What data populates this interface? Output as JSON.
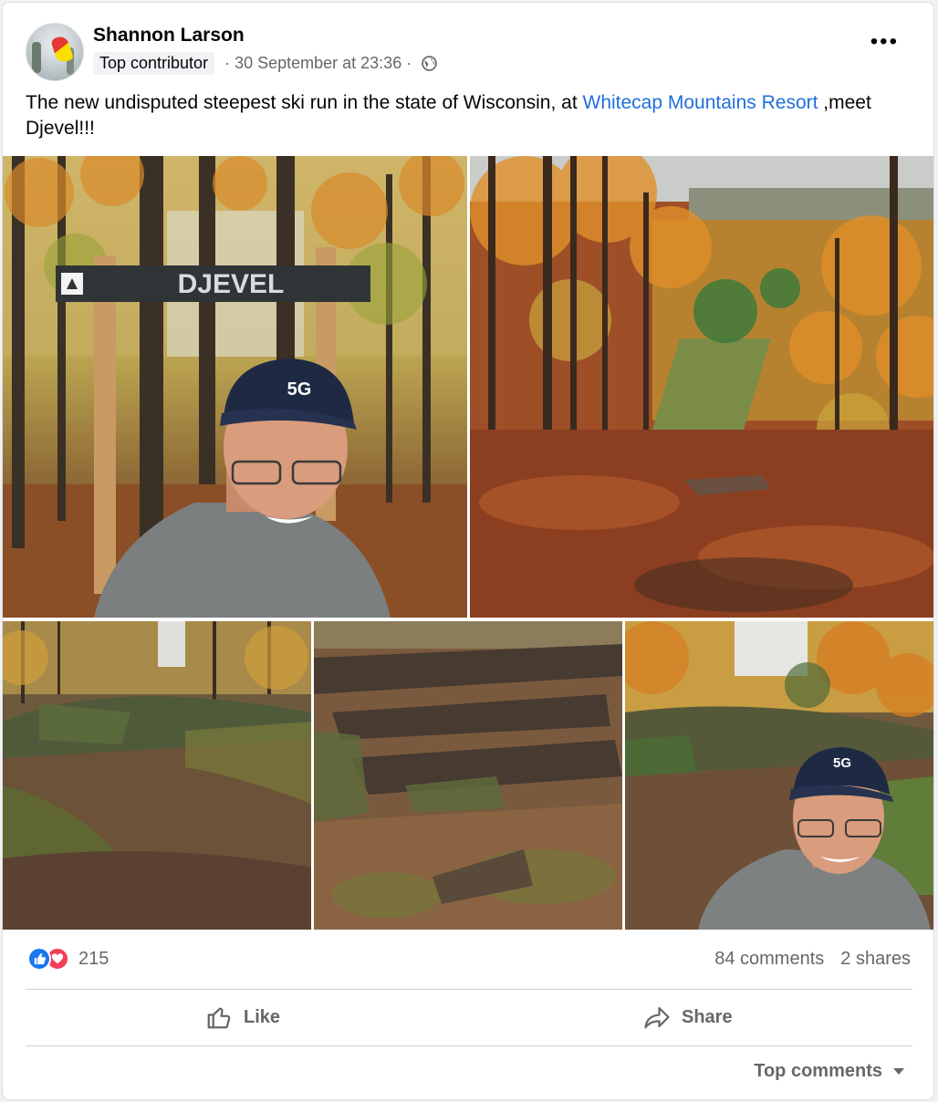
{
  "post": {
    "author": "Shannon Larson",
    "badge": "Top contributor",
    "timestamp": "30 September at 23:36",
    "separator": "·",
    "audience_icon": "globe-icon",
    "more_icon": "more-options-icon",
    "text_before": "The new undisputed steepest ski run in the state of Wisconsin, at ",
    "text_link": "Whitecap Mountains Resort",
    "text_after": " ,meet Djevel!!!"
  },
  "photos": [
    {
      "sign_text": "DJEVEL",
      "cap_text": "5G"
    },
    {},
    {},
    {},
    {
      "cap_text": "5G"
    }
  ],
  "footer": {
    "reaction_count": "215",
    "comments": "84 comments",
    "shares": "2 shares",
    "like_label": "Like",
    "share_label": "Share",
    "sort_label": "Top comments"
  },
  "colors": {
    "link": "#216fdb",
    "like": "#1877f2",
    "love": "#f33e58",
    "muted_text": "#65676b"
  }
}
